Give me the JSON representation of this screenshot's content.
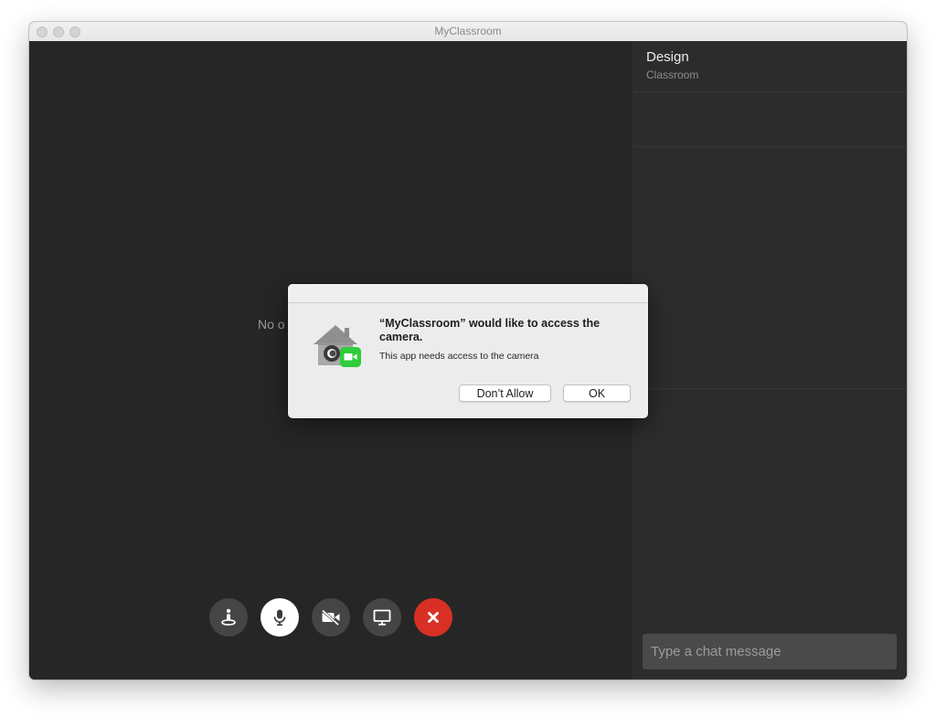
{
  "window": {
    "title": "MyClassroom"
  },
  "stage": {
    "status_text": "No o"
  },
  "sidebar": {
    "title": "Design",
    "subtitle": "Classroom",
    "chat_placeholder": "Type a chat message"
  },
  "controls": [
    {
      "icon": "raise-hand-icon",
      "state": "default"
    },
    {
      "icon": "microphone-icon",
      "state": "active"
    },
    {
      "icon": "camera-off-icon",
      "state": "default"
    },
    {
      "icon": "screen-share-icon",
      "state": "default"
    },
    {
      "icon": "close-icon",
      "state": "end-call"
    }
  ],
  "dialog": {
    "heading": "“MyClassroom” would like to access the camera.",
    "message": "This app needs access to the camera",
    "deny_label": "Don’t Allow",
    "ok_label": "OK",
    "icon": "camera-permission-icon"
  },
  "colors": {
    "stage_bg": "#262626",
    "sidebar_bg": "#2c2c2c",
    "end_call": "#d93025",
    "camera_badge": "#2fcd3a"
  }
}
